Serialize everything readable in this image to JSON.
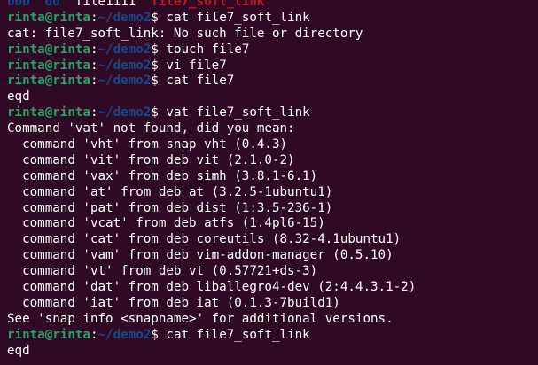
{
  "colors": {
    "background": "#300a24",
    "prompt_user": "#26a269",
    "prompt_path": "#12488b",
    "text": "#ffffff",
    "broken_link": "#c01c28"
  },
  "ls_listing": {
    "entries": [
      {
        "name": "bbb",
        "kind": "directory"
      },
      {
        "name": "dd",
        "kind": "directory"
      },
      {
        "name": "file1111",
        "kind": "file"
      },
      {
        "name": "file7_soft_link",
        "kind": "broken-link"
      }
    ]
  },
  "prompt": {
    "user_host": "rinta@rinta",
    "colon": ":",
    "path": "~/demo2",
    "symbol": "$"
  },
  "lines": [
    {
      "type": "prompt",
      "command": "cat file7_soft_link"
    },
    {
      "type": "output",
      "text": "cat: file7_soft_link: No such file or directory"
    },
    {
      "type": "prompt",
      "command": "touch file7"
    },
    {
      "type": "prompt",
      "command": "vi file7"
    },
    {
      "type": "prompt",
      "command": "cat file7"
    },
    {
      "type": "output",
      "text": "eqd"
    },
    {
      "type": "prompt",
      "command": "vat file7_soft_link"
    },
    {
      "type": "output",
      "text": "Command 'vat' not found, did you mean:"
    },
    {
      "type": "output",
      "text": "  command 'vht' from snap vht (0.4.3)"
    },
    {
      "type": "output",
      "text": "  command 'vit' from deb vit (2.1.0-2)"
    },
    {
      "type": "output",
      "text": "  command 'vax' from deb simh (3.8.1-6.1)"
    },
    {
      "type": "output",
      "text": "  command 'at' from deb at (3.2.5-1ubuntu1)"
    },
    {
      "type": "output",
      "text": "  command 'pat' from deb dist (1:3.5-236-1)"
    },
    {
      "type": "output",
      "text": "  command 'vcat' from deb atfs (1.4pl6-15)"
    },
    {
      "type": "output",
      "text": "  command 'cat' from deb coreutils (8.32-4.1ubuntu1)"
    },
    {
      "type": "output",
      "text": "  command 'vam' from deb vim-addon-manager (0.5.10)"
    },
    {
      "type": "output",
      "text": "  command 'vt' from deb vt (0.57721+ds-3)"
    },
    {
      "type": "output",
      "text": "  command 'dat' from deb liballegro4-dev (2:4.4.3.1-2)"
    },
    {
      "type": "output",
      "text": "  command 'iat' from deb iat (0.1.3-7build1)"
    },
    {
      "type": "output",
      "text": "See 'snap info <snapname>' for additional versions."
    },
    {
      "type": "prompt",
      "command": "cat file7_soft_link"
    },
    {
      "type": "output",
      "text": "eqd"
    }
  ]
}
